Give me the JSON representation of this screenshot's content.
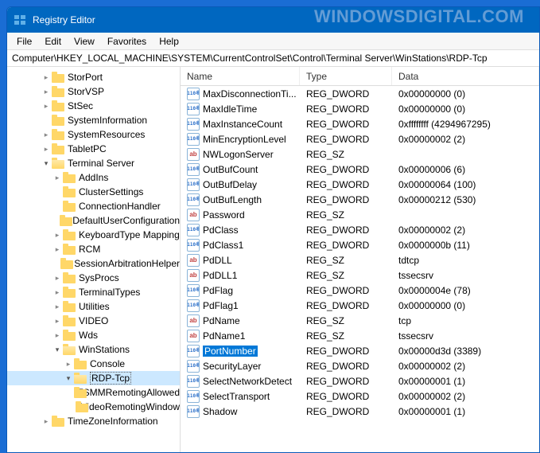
{
  "watermark": "WINDOWSDIGITAL.COM",
  "window": {
    "title": "Registry Editor"
  },
  "menu": {
    "file": "File",
    "edit": "Edit",
    "view": "View",
    "favorites": "Favorites",
    "help": "Help"
  },
  "address": "Computer\\HKEY_LOCAL_MACHINE\\SYSTEM\\CurrentControlSet\\Control\\Terminal Server\\WinStations\\RDP-Tcp",
  "tree": [
    {
      "label": "StorPort",
      "depth": 3,
      "twisty": "closed"
    },
    {
      "label": "StorVSP",
      "depth": 3,
      "twisty": "closed"
    },
    {
      "label": "StSec",
      "depth": 3,
      "twisty": "closed"
    },
    {
      "label": "SystemInformation",
      "depth": 3,
      "twisty": "none"
    },
    {
      "label": "SystemResources",
      "depth": 3,
      "twisty": "closed"
    },
    {
      "label": "TabletPC",
      "depth": 3,
      "twisty": "closed"
    },
    {
      "label": "Terminal Server",
      "depth": 3,
      "twisty": "open",
      "open": true
    },
    {
      "label": "AddIns",
      "depth": 4,
      "twisty": "closed"
    },
    {
      "label": "ClusterSettings",
      "depth": 4,
      "twisty": "none"
    },
    {
      "label": "ConnectionHandler",
      "depth": 4,
      "twisty": "none"
    },
    {
      "label": "DefaultUserConfiguration",
      "depth": 4,
      "twisty": "none"
    },
    {
      "label": "KeyboardType Mapping",
      "depth": 4,
      "twisty": "closed"
    },
    {
      "label": "RCM",
      "depth": 4,
      "twisty": "closed"
    },
    {
      "label": "SessionArbitrationHelper",
      "depth": 4,
      "twisty": "none"
    },
    {
      "label": "SysProcs",
      "depth": 4,
      "twisty": "closed"
    },
    {
      "label": "TerminalTypes",
      "depth": 4,
      "twisty": "closed"
    },
    {
      "label": "Utilities",
      "depth": 4,
      "twisty": "closed"
    },
    {
      "label": "VIDEO",
      "depth": 4,
      "twisty": "closed"
    },
    {
      "label": "Wds",
      "depth": 4,
      "twisty": "closed"
    },
    {
      "label": "WinStations",
      "depth": 4,
      "twisty": "open",
      "open": true
    },
    {
      "label": "Console",
      "depth": 5,
      "twisty": "closed"
    },
    {
      "label": "RDP-Tcp",
      "depth": 5,
      "twisty": "open",
      "open": true,
      "selected": true
    },
    {
      "label": "TSMMRemotingAllowed",
      "depth": 6,
      "twisty": "none"
    },
    {
      "label": "VideoRemotingWindow",
      "depth": 6,
      "twisty": "none"
    },
    {
      "label": "TimeZoneInformation",
      "depth": 3,
      "twisty": "closed"
    }
  ],
  "columns": {
    "name": "Name",
    "type": "Type",
    "data": "Data"
  },
  "values": [
    {
      "name": "MaxDisconnectionTi...",
      "type": "REG_DWORD",
      "data": "0x00000000 (0)",
      "kind": "bin"
    },
    {
      "name": "MaxIdleTime",
      "type": "REG_DWORD",
      "data": "0x00000000 (0)",
      "kind": "bin"
    },
    {
      "name": "MaxInstanceCount",
      "type": "REG_DWORD",
      "data": "0xffffffff (4294967295)",
      "kind": "bin"
    },
    {
      "name": "MinEncryptionLevel",
      "type": "REG_DWORD",
      "data": "0x00000002 (2)",
      "kind": "bin"
    },
    {
      "name": "NWLogonServer",
      "type": "REG_SZ",
      "data": "",
      "kind": "str"
    },
    {
      "name": "OutBufCount",
      "type": "REG_DWORD",
      "data": "0x00000006 (6)",
      "kind": "bin"
    },
    {
      "name": "OutBufDelay",
      "type": "REG_DWORD",
      "data": "0x00000064 (100)",
      "kind": "bin"
    },
    {
      "name": "OutBufLength",
      "type": "REG_DWORD",
      "data": "0x00000212 (530)",
      "kind": "bin"
    },
    {
      "name": "Password",
      "type": "REG_SZ",
      "data": "",
      "kind": "str"
    },
    {
      "name": "PdClass",
      "type": "REG_DWORD",
      "data": "0x00000002 (2)",
      "kind": "bin"
    },
    {
      "name": "PdClass1",
      "type": "REG_DWORD",
      "data": "0x0000000b (11)",
      "kind": "bin"
    },
    {
      "name": "PdDLL",
      "type": "REG_SZ",
      "data": "tdtcp",
      "kind": "str"
    },
    {
      "name": "PdDLL1",
      "type": "REG_SZ",
      "data": "tssecsrv",
      "kind": "str"
    },
    {
      "name": "PdFlag",
      "type": "REG_DWORD",
      "data": "0x0000004e (78)",
      "kind": "bin"
    },
    {
      "name": "PdFlag1",
      "type": "REG_DWORD",
      "data": "0x00000000 (0)",
      "kind": "bin"
    },
    {
      "name": "PdName",
      "type": "REG_SZ",
      "data": "tcp",
      "kind": "str"
    },
    {
      "name": "PdName1",
      "type": "REG_SZ",
      "data": "tssecsrv",
      "kind": "str"
    },
    {
      "name": "PortNumber",
      "type": "REG_DWORD",
      "data": "0x00000d3d (3389)",
      "kind": "bin",
      "selected": true
    },
    {
      "name": "SecurityLayer",
      "type": "REG_DWORD",
      "data": "0x00000002 (2)",
      "kind": "bin"
    },
    {
      "name": "SelectNetworkDetect",
      "type": "REG_DWORD",
      "data": "0x00000001 (1)",
      "kind": "bin"
    },
    {
      "name": "SelectTransport",
      "type": "REG_DWORD",
      "data": "0x00000002 (2)",
      "kind": "bin"
    },
    {
      "name": "Shadow",
      "type": "REG_DWORD",
      "data": "0x00000001 (1)",
      "kind": "bin"
    }
  ]
}
